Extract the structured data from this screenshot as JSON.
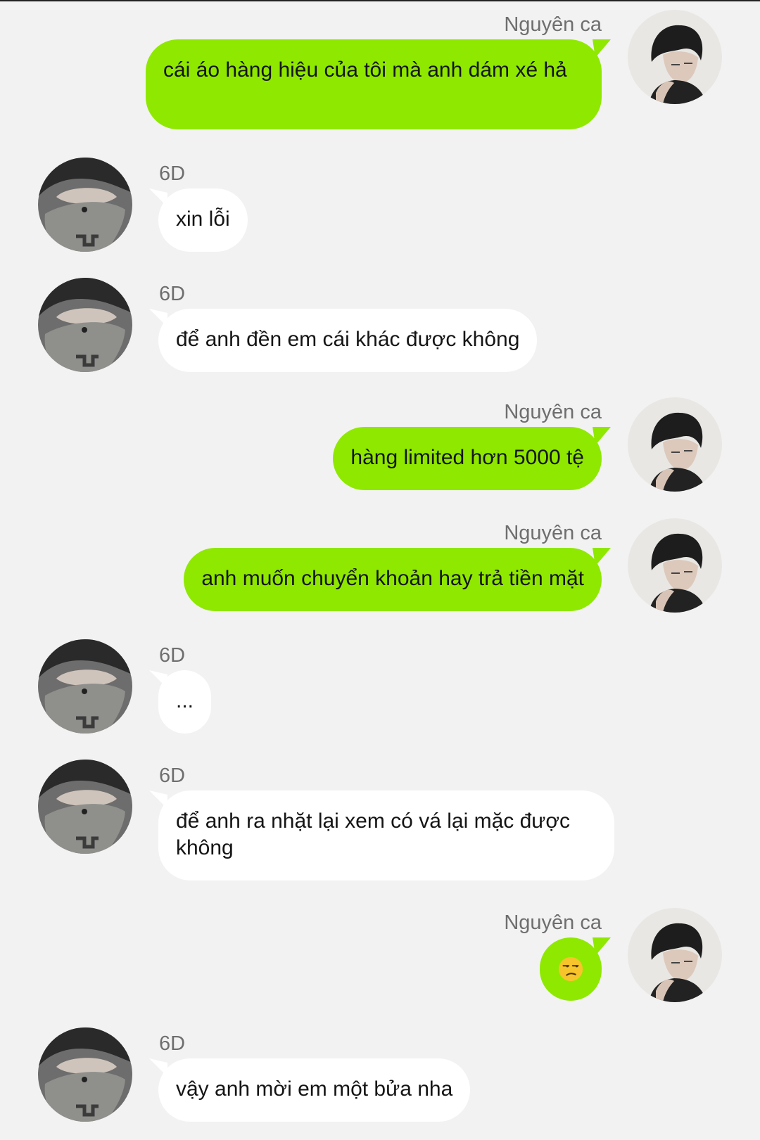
{
  "colors": {
    "background": "#f2f2f2",
    "own_bubble": "#8fe800",
    "other_bubble": "#ffffff",
    "sender_name": "#6e6e6e",
    "text": "#151515"
  },
  "messages": [
    {
      "side": "right",
      "sender": "Nguyên ca",
      "text": "cái áo hàng hiệu của tôi mà anh dám xé hả"
    },
    {
      "side": "left",
      "sender": "6D",
      "text": "xin lỗi"
    },
    {
      "side": "left",
      "sender": "6D",
      "text": "để anh đền em cái khác được không"
    },
    {
      "side": "right",
      "sender": "Nguyên ca",
      "text": "hàng limited hơn 5000 tệ"
    },
    {
      "side": "right",
      "sender": "Nguyên ca",
      "text": "anh muốn chuyển khoản hay trả tiền mặt"
    },
    {
      "side": "left",
      "sender": "6D",
      "text": "..."
    },
    {
      "side": "left",
      "sender": "6D",
      "text": "để anh ra nhặt lại xem có vá lại mặc được không"
    },
    {
      "side": "right",
      "sender": "Nguyên ca",
      "text": "😒",
      "icon": "unamused-face-emoji"
    },
    {
      "side": "left",
      "sender": "6D",
      "text": "vậy anh mời em một bửa nha"
    }
  ]
}
